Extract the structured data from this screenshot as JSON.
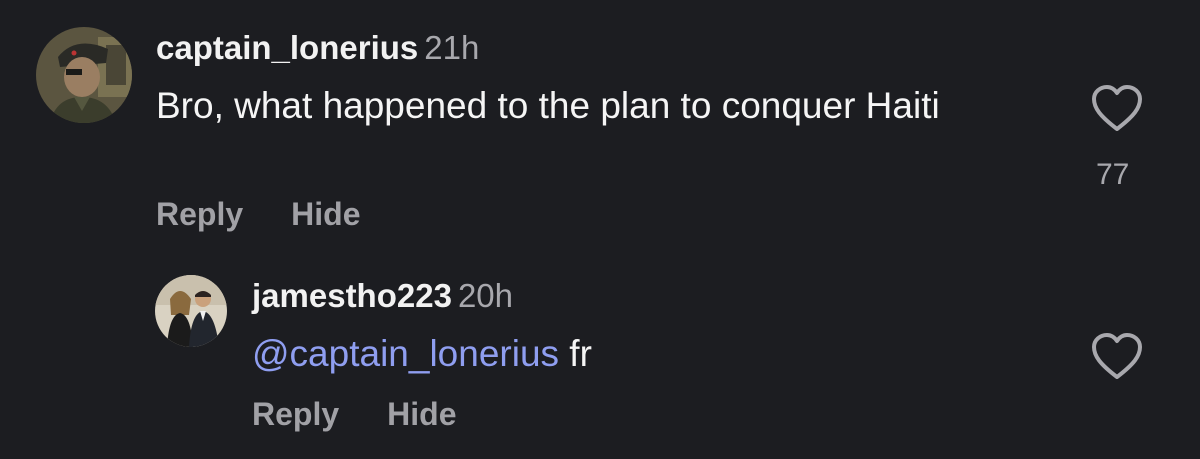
{
  "comments": [
    {
      "username": "captain_lonerius",
      "time": "21h",
      "text": "Bro, what happened to the plan to conquer Haiti",
      "actions": {
        "reply": "Reply",
        "hide": "Hide"
      },
      "likes": "77",
      "avatar": "avatar-soldier-eyepatch",
      "like_icon": "heart-outline-icon"
    },
    {
      "username": "jamestho223",
      "time": "20h",
      "mention": "@captain_lonerius",
      "text": " fr",
      "actions": {
        "reply": "Reply",
        "hide": "Hide"
      },
      "avatar": "avatar-couple-photo",
      "like_icon": "heart-outline-icon"
    }
  ],
  "colors": {
    "background": "#1c1d21",
    "username": "#f2f2f2",
    "secondary": "#a1a1a6",
    "mention": "#8f9ef0"
  }
}
